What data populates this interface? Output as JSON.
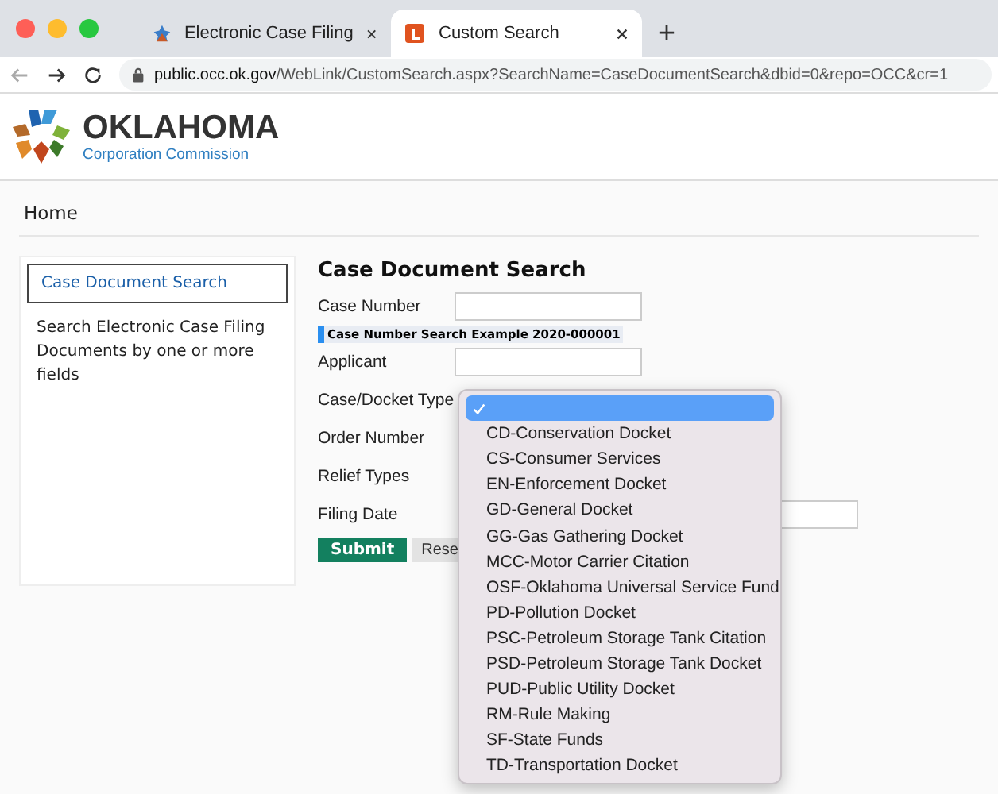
{
  "browser": {
    "tabs": [
      {
        "title": "Electronic Case Filing",
        "selected": false
      },
      {
        "title": "Custom Search",
        "selected": true
      }
    ],
    "url_host": "public.occ.ok.gov",
    "url_path": "/WebLink/CustomSearch.aspx?SearchName=CaseDocumentSearch&dbid=0&repo=OCC&cr=1"
  },
  "logo": {
    "name": "OKLAHOMA",
    "subtitle": "Corporation Commission"
  },
  "nav": {
    "items": [
      "Home"
    ]
  },
  "sidebar": {
    "items": [
      {
        "label": "Case Document Search",
        "selected": true
      }
    ],
    "description": "Search Electronic Case Filing Documents by one or more fields"
  },
  "form": {
    "title": "Case Document Search",
    "fields": [
      {
        "label": "Case Number",
        "kind": "input"
      },
      {
        "kind": "hint",
        "label": "Case Number Search Example 2020-000001"
      },
      {
        "label": "Applicant",
        "kind": "input"
      },
      {
        "label": "Case/Docket Type",
        "kind": "select"
      },
      {
        "label": "Order Number",
        "kind": "covered"
      },
      {
        "label": "Relief Types",
        "kind": "covered"
      },
      {
        "label": "Filing Date",
        "kind": "date"
      }
    ],
    "buttons": [
      {
        "label": "Submit",
        "kind": "primary"
      },
      {
        "label": "Rese",
        "kind": "secondary"
      }
    ]
  },
  "dropdown": {
    "options": [
      {
        "selected": true
      },
      {
        "label": "CD-Conservation Docket",
        "selected": false
      },
      {
        "label": "CS-Consumer Services",
        "selected": false
      },
      {
        "label": "EN-Enforcement Docket",
        "selected": false
      },
      {
        "label": "GD-General Docket",
        "selected": false
      },
      {
        "label": "GG-Gas Gathering Docket",
        "selected": false
      },
      {
        "label": "MCC-Motor Carrier Citation",
        "selected": false
      },
      {
        "label": "OSF-Oklahoma Universal Service Fund",
        "selected": false
      },
      {
        "label": "PD-Pollution Docket",
        "selected": false
      },
      {
        "label": "PSC-Petroleum Storage Tank Citation",
        "selected": false
      },
      {
        "label": "PSD-Petroleum Storage Tank Docket",
        "selected": false
      },
      {
        "label": "PUD-Public Utility Docket",
        "selected": false
      },
      {
        "label": "RM-Rule Making",
        "selected": false
      },
      {
        "label": "SF-State Funds",
        "selected": false
      },
      {
        "label": "TD-Transportation Docket",
        "selected": false
      }
    ]
  }
}
